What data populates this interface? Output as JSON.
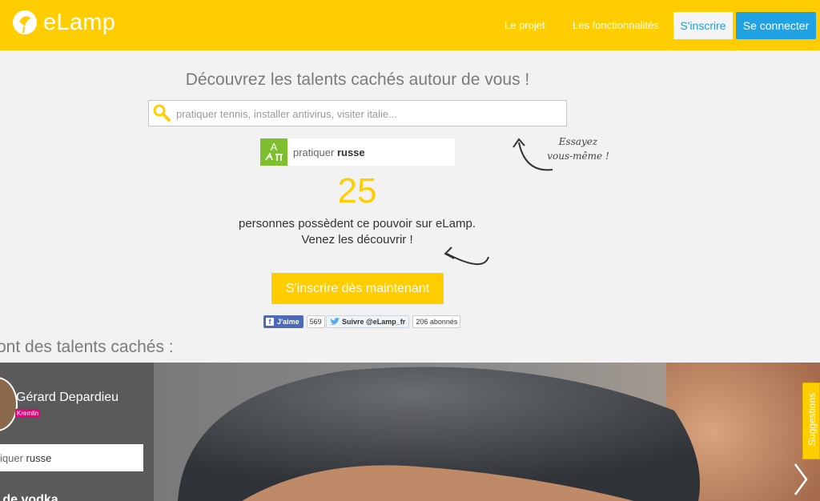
{
  "header": {
    "logo_text": "eLamp",
    "nav": [
      {
        "label": "Le projet"
      },
      {
        "label": "Les fonctionnalités"
      }
    ],
    "signup_label": "S'inscrire",
    "login_label": "Se connecter"
  },
  "hero": {
    "headline": "Découvrez les talents cachés autour de vous !",
    "search_placeholder": "pratiquer tennis, installer antivirus, visiter italie...",
    "skill_prefix": "pratiquer",
    "skill_value": "russe",
    "count": "25",
    "count_line1": "personnes possèdent ce pouvoir sur eLamp.",
    "count_line2": "Venez les découvrir !",
    "try_line1": "Essayez",
    "try_line2": "vous-même !",
    "cta_label": "S'inscrire dès maintenant"
  },
  "social": {
    "fb_label": "J'aime",
    "fb_count": "569",
    "tw_label": "Suivre @eLamp_fr",
    "tw_count": "206 abonnés"
  },
  "section": {
    "title": "ont des talents cachés :"
  },
  "showcase": {
    "person_name": "Gérard Depardieu",
    "person_badge": "Kremlin",
    "skill_prefix": "iquer",
    "skill_value": "russe",
    "bottom_text": "e de vodka",
    "suggestions_label": "Suggestions"
  },
  "colors": {
    "brand_yellow": "#ffcd00",
    "login_blue": "#1fa3e4",
    "skill_green": "#7dbf2e",
    "badge_pink": "#e6007e"
  },
  "icons": {
    "logo": "lamp-bulb-icon",
    "search": "magnifier-icon",
    "skill": "translate-icon",
    "next": "chevron-right-icon"
  }
}
